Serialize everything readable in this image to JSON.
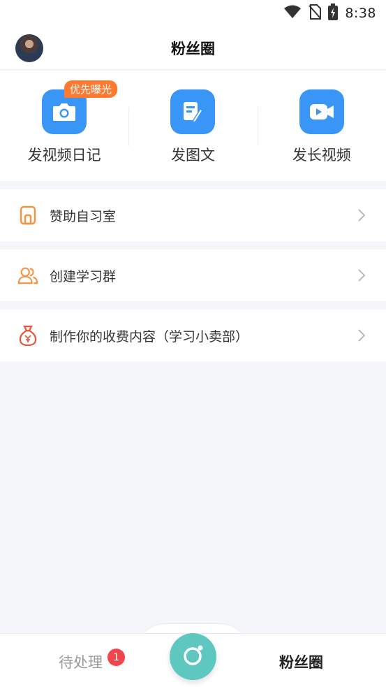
{
  "status_bar": {
    "time": "8:38"
  },
  "header": {
    "title": "粉丝圈"
  },
  "post_options": [
    {
      "label": "发视频日记",
      "badge": "优先曝光",
      "icon": "camera-icon"
    },
    {
      "label": "发图文",
      "icon": "edit-note-icon"
    },
    {
      "label": "发长视频",
      "icon": "video-camera-icon"
    }
  ],
  "menu": [
    {
      "label": "赞助自习室",
      "icon": "study-room-icon",
      "color": "#f5923e"
    },
    {
      "label": "创建学习群",
      "icon": "group-icon",
      "color": "#f5923e"
    },
    {
      "label": "制作你的收费内容（学习小卖部）",
      "icon": "money-bag-icon",
      "color": "#e8563f"
    }
  ],
  "bottom_nav": {
    "pending_label": "待处理",
    "pending_count": "1",
    "center_icon": "record-icon",
    "fans_label": "粉丝圈"
  },
  "colors": {
    "accent_blue": "#3a96f6",
    "teal": "#5ec7c0",
    "orange": "#ff7a30",
    "badge_red": "#f0454b"
  }
}
